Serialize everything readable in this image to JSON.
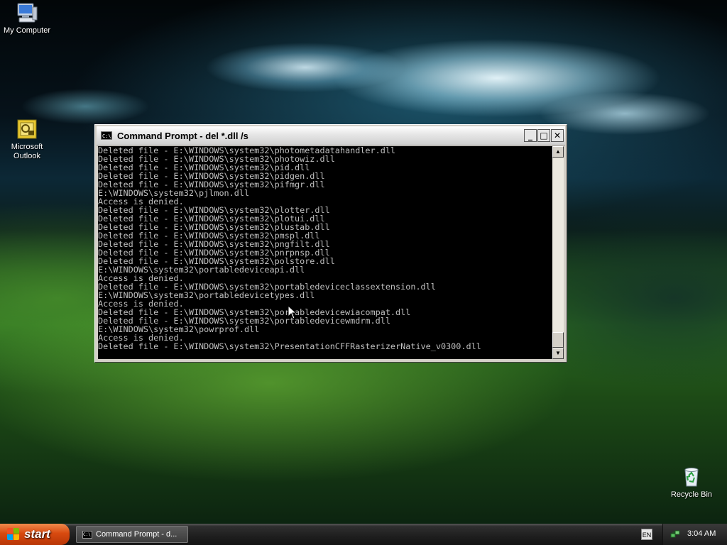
{
  "desktop": {
    "icons": [
      {
        "label": "My Computer"
      },
      {
        "label": "Microsoft Outlook"
      },
      {
        "label": "Recycle Bin"
      }
    ]
  },
  "window": {
    "title": "Command Prompt - del *.dll /s",
    "console_lines": [
      "Deleted file - E:\\WINDOWS\\system32\\photometadatahandler.dll",
      "Deleted file - E:\\WINDOWS\\system32\\photowiz.dll",
      "Deleted file - E:\\WINDOWS\\system32\\pid.dll",
      "Deleted file - E:\\WINDOWS\\system32\\pidgen.dll",
      "Deleted file - E:\\WINDOWS\\system32\\pifmgr.dll",
      "E:\\WINDOWS\\system32\\pjlmon.dll",
      "Access is denied.",
      "Deleted file - E:\\WINDOWS\\system32\\plotter.dll",
      "Deleted file - E:\\WINDOWS\\system32\\plotui.dll",
      "Deleted file - E:\\WINDOWS\\system32\\plustab.dll",
      "Deleted file - E:\\WINDOWS\\system32\\pmspl.dll",
      "Deleted file - E:\\WINDOWS\\system32\\pngfilt.dll",
      "Deleted file - E:\\WINDOWS\\system32\\pnrpnsp.dll",
      "Deleted file - E:\\WINDOWS\\system32\\polstore.dll",
      "E:\\WINDOWS\\system32\\portabledeviceapi.dll",
      "Access is denied.",
      "Deleted file - E:\\WINDOWS\\system32\\portabledeviceclassextension.dll",
      "E:\\WINDOWS\\system32\\portabledevicetypes.dll",
      "Access is denied.",
      "Deleted file - E:\\WINDOWS\\system32\\portabledevicewiacompat.dll",
      "Deleted file - E:\\WINDOWS\\system32\\portabledevicewmdrm.dll",
      "E:\\WINDOWS\\system32\\powrprof.dll",
      "Access is denied.",
      "Deleted file - E:\\WINDOWS\\system32\\PresentationCFFRasterizerNative_v0300.dll"
    ],
    "title_icon_text": "C:\\",
    "buttons": {
      "minimize": "_",
      "maximize": "□",
      "close": "✕"
    }
  },
  "taskbar": {
    "start_label": "start",
    "task_button_label": "Command Prompt - d...",
    "language": "EN",
    "clock": "3:04 AM"
  },
  "colors": {
    "console_bg": "#000000",
    "console_text": "#c0c0c0",
    "start_orange": "#d84a10"
  },
  "icons_semantic": [
    "my-computer-icon",
    "outlook-icon",
    "recycle-bin-icon",
    "cmd-icon",
    "windows-logo-icon",
    "network-icon"
  ]
}
